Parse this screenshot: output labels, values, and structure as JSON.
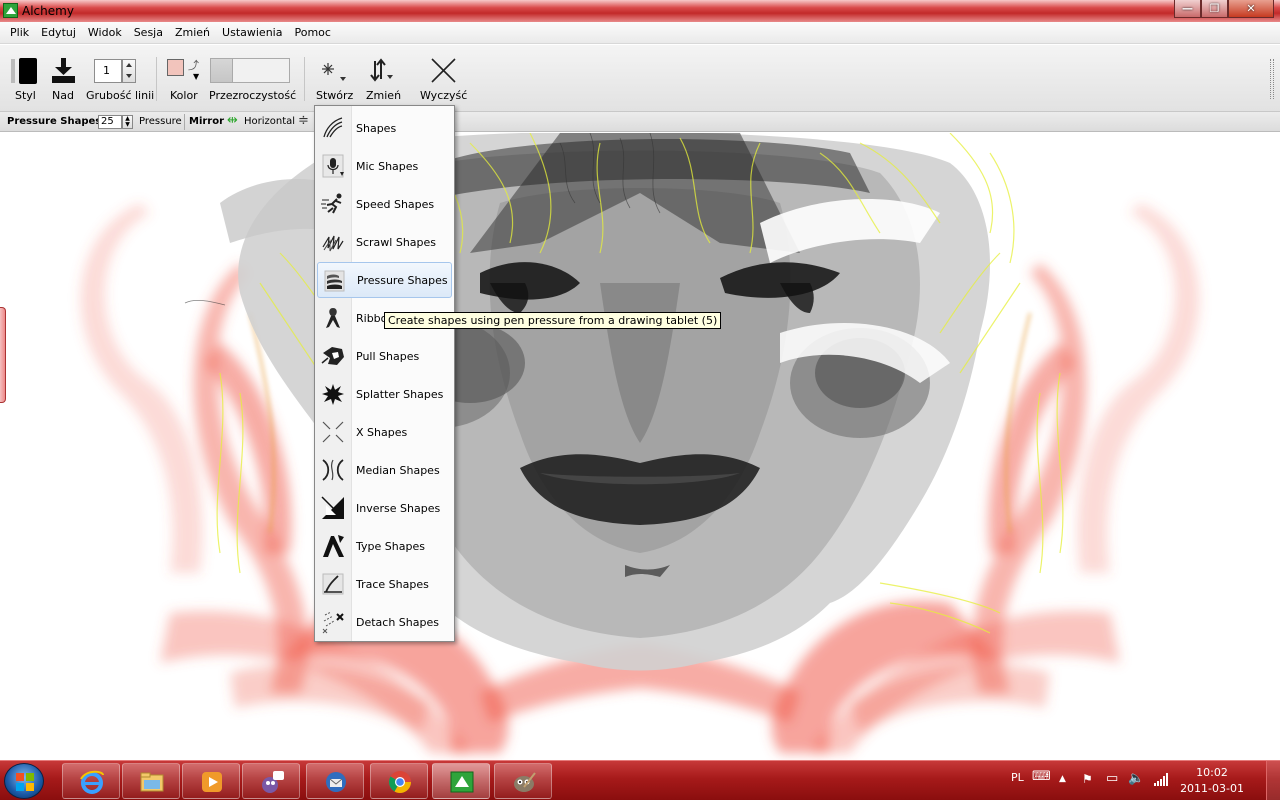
{
  "window": {
    "title": "Alchemy"
  },
  "window_controls": {
    "minimize": "—",
    "maximize": "❐",
    "close": "✕"
  },
  "menu": [
    "Plik",
    "Edytuj",
    "Widok",
    "Sesja",
    "Zmień",
    "Ustawienia",
    "Pomoc"
  ],
  "toolbar": {
    "style_label": "Styl",
    "above_label": "Nad",
    "line_width_label": "Grubość linii",
    "line_width_value": "1",
    "color_label": "Kolor",
    "transparency_label": "Przezroczystość",
    "create_label": "Stwórz",
    "modify_label": "Zmień",
    "clear_label": "Wyczyść",
    "color_swatch": "#f2c4bc"
  },
  "subtoolbar": {
    "pressure_shapes_label": "Pressure Shapes",
    "pressure_value": "25",
    "pressure_label": "Pressure",
    "mirror_label": "Mirror",
    "horizontal_label": "Horizontal"
  },
  "create_menu": {
    "items": [
      {
        "label": "Shapes",
        "icon": "shapes-icon"
      },
      {
        "label": "Mic Shapes",
        "icon": "microphone-icon"
      },
      {
        "label": "Speed Shapes",
        "icon": "runner-icon"
      },
      {
        "label": "Scrawl Shapes",
        "icon": "scrawl-icon"
      },
      {
        "label": "Pressure Shapes",
        "icon": "pressure-icon",
        "selected": true
      },
      {
        "label": "Ribbo",
        "icon": "ribbon-icon"
      },
      {
        "label": "Pull Shapes",
        "icon": "pull-icon"
      },
      {
        "label": "Splatter Shapes",
        "icon": "splatter-icon"
      },
      {
        "label": "X Shapes",
        "icon": "x-shapes-icon"
      },
      {
        "label": "Median Shapes",
        "icon": "median-icon"
      },
      {
        "label": "Inverse Shapes",
        "icon": "inverse-icon"
      },
      {
        "label": "Type Shapes",
        "icon": "type-icon"
      },
      {
        "label": "Trace Shapes",
        "icon": "trace-icon"
      },
      {
        "label": "Detach Shapes",
        "icon": "detach-icon"
      }
    ]
  },
  "tooltip": {
    "text": "Create shapes using pen pressure from a drawing tablet (5)"
  },
  "taskbar": {
    "apps": [
      "internet-explorer-icon",
      "file-explorer-icon",
      "media-player-icon",
      "messenger-icon",
      "thunderbird-icon",
      "chrome-icon",
      "alchemy-icon",
      "gimp-icon"
    ],
    "language": "PL",
    "time": "10:02",
    "date": "2011-03-01"
  }
}
